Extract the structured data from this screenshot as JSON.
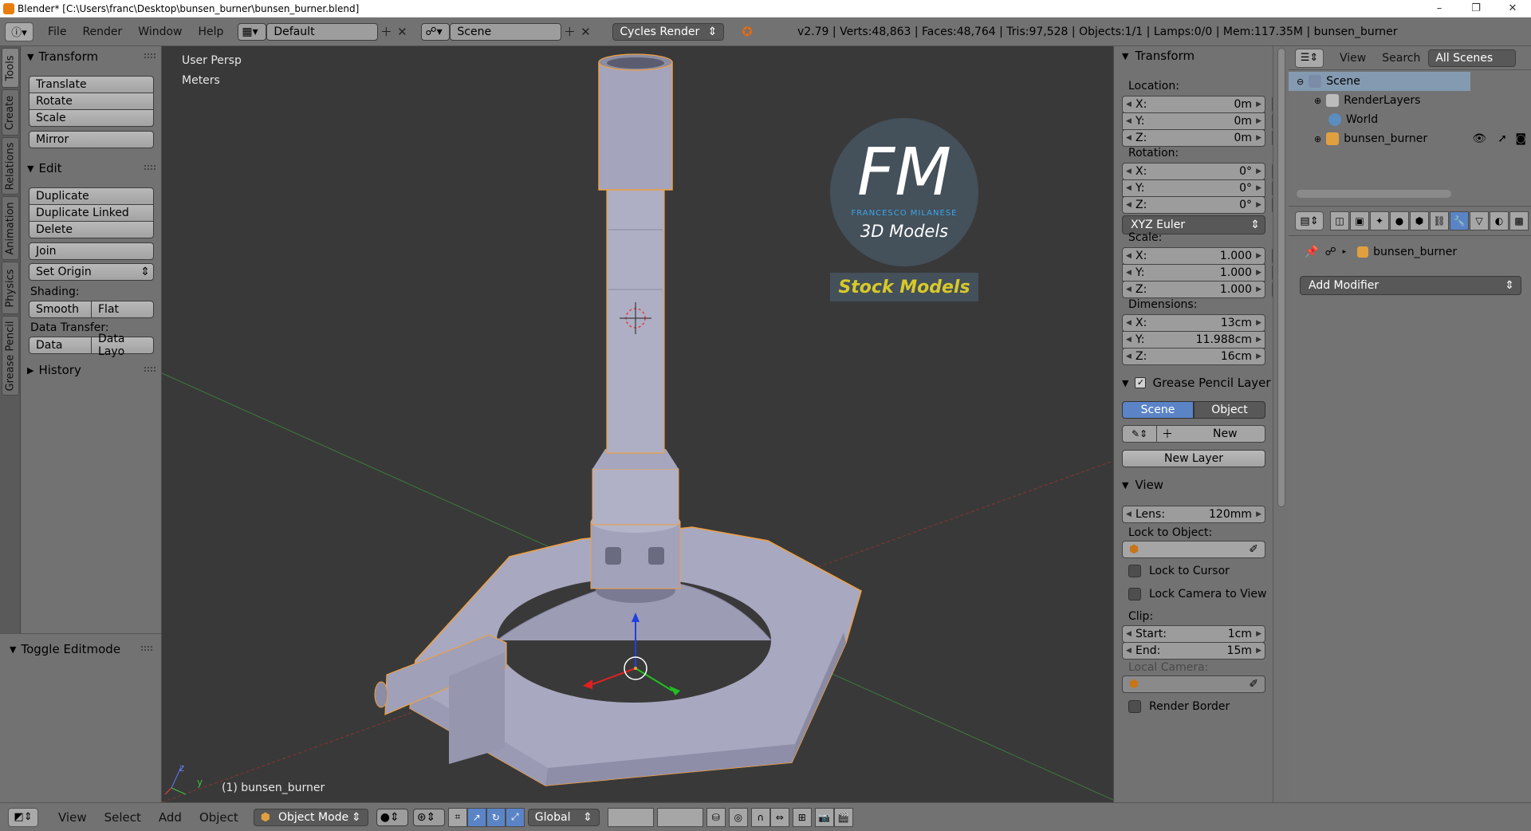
{
  "window": {
    "title": "Blender* [C:\\Users\\franc\\Desktop\\bunsen_burner\\bunsen_burner.blend]",
    "minimize": "–",
    "restore": "❐",
    "close": "✕"
  },
  "infobar": {
    "menus": [
      "File",
      "Render",
      "Window",
      "Help"
    ],
    "screen_layout": "Default",
    "scene": "Scene",
    "render_engine": "Cycles Render",
    "stats": "v2.79 | Verts:48,863 | Faces:48,764 | Tris:97,528 | Objects:1/1 | Lamps:0/0 | Mem:117.35M | bunsen_burner"
  },
  "tabs": [
    "Tools",
    "Create",
    "Relations",
    "Animation",
    "Physics",
    "Grease Pencil"
  ],
  "toolshelf": {
    "transform": {
      "title": "Transform",
      "translate": "Translate",
      "rotate": "Rotate",
      "scale": "Scale",
      "mirror": "Mirror"
    },
    "edit": {
      "title": "Edit",
      "duplicate": "Duplicate",
      "duplicate_linked": "Duplicate Linked",
      "delete": "Delete",
      "join": "Join",
      "set_origin": "Set Origin",
      "shading_label": "Shading:",
      "smooth": "Smooth",
      "flat": "Flat",
      "data_transfer_label": "Data Transfer:",
      "data": "Data",
      "data_layout": "Data Layo"
    },
    "history": {
      "title": "History"
    },
    "toggle_editmode": "Toggle Editmode"
  },
  "viewport": {
    "view_name": "User Persp",
    "units": "Meters",
    "object_label": "(1) bunsen_burner",
    "watermark": {
      "logo": "FM",
      "company": "FRANCESCO MILANESE",
      "subtitle": "3D Models",
      "stock": "Stock Models"
    },
    "axis_y": "y",
    "axis_z": "z"
  },
  "properties": {
    "transform": {
      "title": "Transform",
      "location_label": "Location:",
      "location": [
        {
          "k": "X:",
          "v": "0m"
        },
        {
          "k": "Y:",
          "v": "0m"
        },
        {
          "k": "Z:",
          "v": "0m"
        }
      ],
      "rotation_label": "Rotation:",
      "rotation": [
        {
          "k": "X:",
          "v": "0°"
        },
        {
          "k": "Y:",
          "v": "0°"
        },
        {
          "k": "Z:",
          "v": "0°"
        }
      ],
      "rotation_mode": "XYZ Euler",
      "scale_label": "Scale:",
      "scale": [
        {
          "k": "X:",
          "v": "1.000"
        },
        {
          "k": "Y:",
          "v": "1.000"
        },
        {
          "k": "Z:",
          "v": "1.000"
        }
      ],
      "dimensions_label": "Dimensions:",
      "dimensions": [
        {
          "k": "X:",
          "v": "13cm"
        },
        {
          "k": "Y:",
          "v": "11.988cm"
        },
        {
          "k": "Z:",
          "v": "16cm"
        }
      ]
    },
    "grease_pencil": {
      "title": "Grease Pencil Layer",
      "scene": "Scene",
      "object": "Object",
      "new": "New",
      "new_layer": "New Layer"
    },
    "view": {
      "title": "View",
      "lens_label": "Lens:",
      "lens": "120mm",
      "lock_to_object": "Lock to Object:",
      "lock_to_cursor": "Lock to Cursor",
      "lock_camera": "Lock Camera to View",
      "clip_label": "Clip:",
      "start_label": "Start:",
      "start": "1cm",
      "end_label": "End:",
      "end": "15m",
      "local_camera": "Local Camera:",
      "render_border": "Render Border"
    }
  },
  "outliner": {
    "menus": [
      "View",
      "Search"
    ],
    "display_mode": "All Scenes",
    "items": [
      "Scene",
      "RenderLayers",
      "World",
      "bunsen_burner"
    ]
  },
  "modifiers": {
    "object_name": "bunsen_burner",
    "add_modifier": "Add Modifier"
  },
  "bottombar": {
    "menus": [
      "View",
      "Select",
      "Add",
      "Object"
    ],
    "mode": "Object Mode",
    "orientation": "Global"
  },
  "colors": {
    "accent": "#5a84c6",
    "selection_outline": "#f0a040",
    "stock_text": "#d8c92a",
    "logo_blue": "#3aa6e8"
  }
}
